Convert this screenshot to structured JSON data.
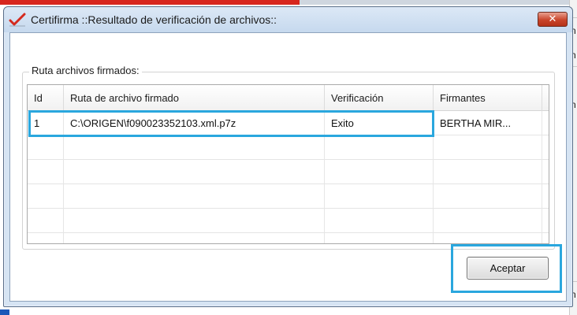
{
  "background": {
    "right_chars": [
      "n",
      "n",
      "n",
      "n"
    ]
  },
  "dialog": {
    "title": "Certifirma ::Resultado de verificación de archivos::",
    "close_label": "✕",
    "icon": "checkmark-red-icon"
  },
  "group": {
    "label": "Ruta archivos firmados:"
  },
  "table": {
    "columns": [
      "Id",
      "Ruta de archivo firmado",
      "Verificación",
      "Firmantes"
    ],
    "rows": [
      {
        "id": "1",
        "ruta": "C:\\ORIGEN\\f090023352103.xml.p7z",
        "verificacion": "Exito",
        "firmantes": "BERTHA MIR..."
      }
    ]
  },
  "buttons": {
    "accept_label": "Aceptar"
  },
  "colors": {
    "highlight": "#2aa7de",
    "close_button": "#c9452b",
    "title_bar": "#c6d9ee"
  }
}
